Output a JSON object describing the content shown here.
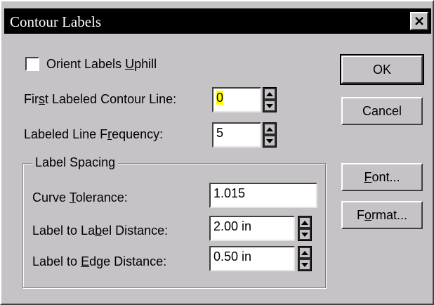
{
  "window": {
    "title": "Contour Labels"
  },
  "orient": {
    "label_pre": "Orient Labels ",
    "label_u": "U",
    "label_post": "phill",
    "checked": false
  },
  "first_contour": {
    "label_pre": "Fir",
    "label_u": "s",
    "label_post": "t Labeled Contour Line:",
    "value": "0"
  },
  "frequency": {
    "label_pre": "Labeled Line F",
    "label_u": "r",
    "label_post": "equency:",
    "value": "5"
  },
  "spacing": {
    "group_title": "Label Spacing",
    "curve": {
      "label_pre": "Curve ",
      "label_u": "T",
      "label_post": "olerance:",
      "value": "1.015"
    },
    "label_dist": {
      "label_pre": "Label to La",
      "label_u": "b",
      "label_post": "el Distance:",
      "value": "2.00 in"
    },
    "edge_dist": {
      "label_pre": "Label to ",
      "label_u": "E",
      "label_post": "dge Distance:",
      "value": "0.50 in"
    }
  },
  "buttons": {
    "ok": "OK",
    "cancel": "Cancel",
    "font": {
      "u": "F",
      "rest": "ont..."
    },
    "format": {
      "pre": "F",
      "u": "o",
      "rest": "rmat..."
    }
  },
  "icons": {
    "close": "close-icon",
    "up": "arrow-up-icon",
    "down": "arrow-down-icon"
  }
}
